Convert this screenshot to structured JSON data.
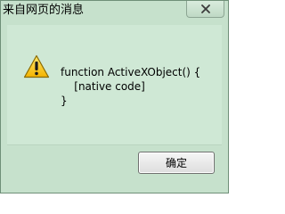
{
  "window": {
    "title": "来自网页的消息"
  },
  "message": {
    "text": "function ActiveXObject() {\n    [native code]\n}"
  },
  "buttons": {
    "ok_label": "确定"
  },
  "icons": {
    "close": "close-icon",
    "warning": "warning-icon"
  },
  "colors": {
    "dialog_bg": "#c6e1cc",
    "content_bg": "#cfe8d5"
  }
}
